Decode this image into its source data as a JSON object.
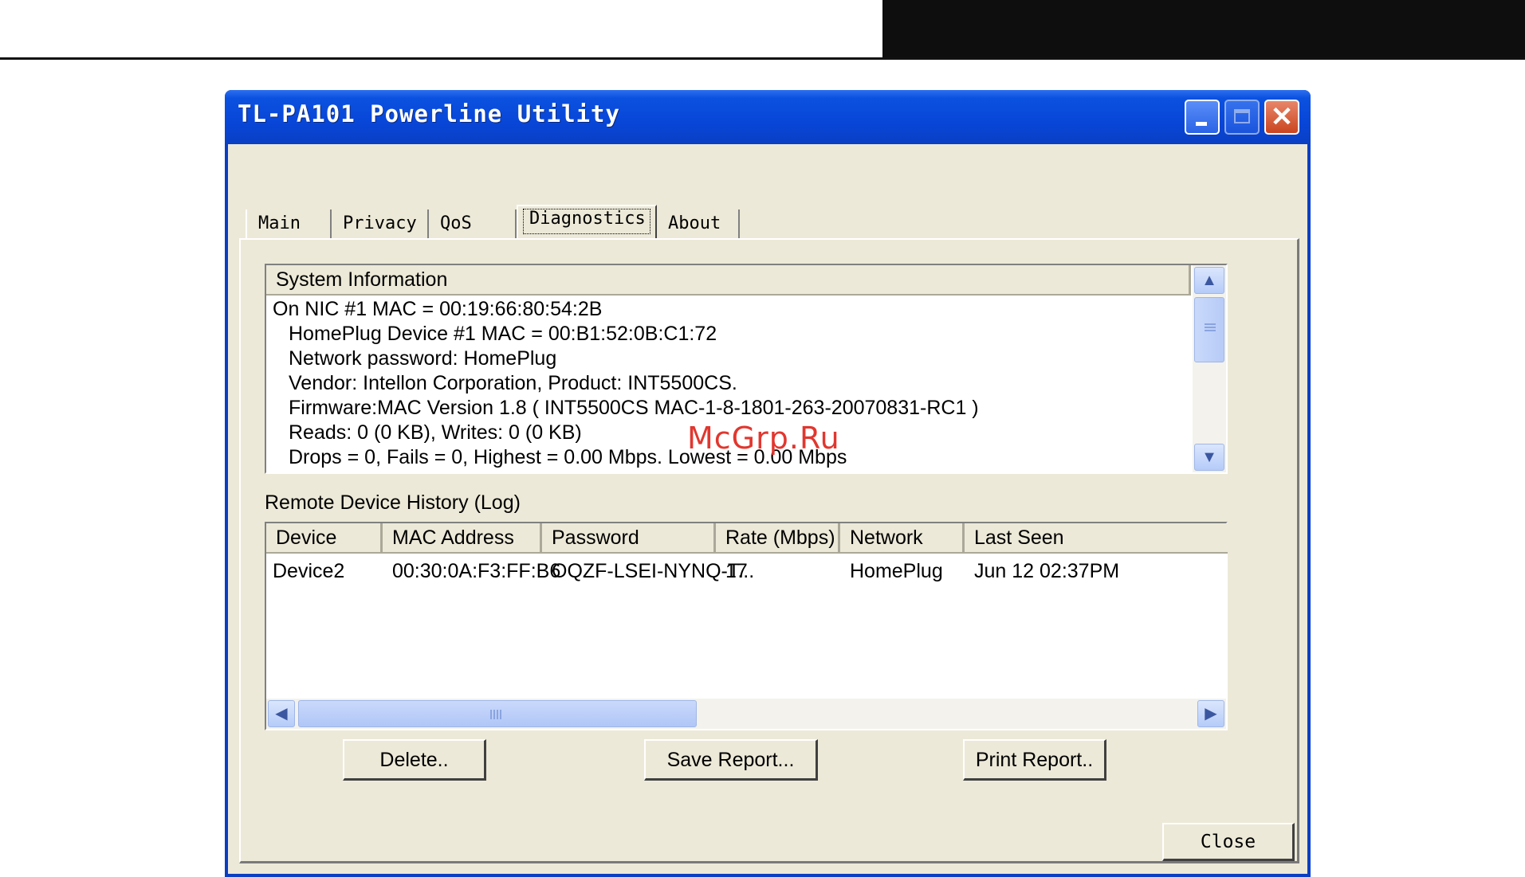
{
  "window": {
    "title": "TL-PA101 Powerline Utility",
    "close_glyph": "✕"
  },
  "tabs": [
    {
      "label": "Main"
    },
    {
      "label": "Privacy"
    },
    {
      "label": "QoS"
    },
    {
      "label": "Diagnostics",
      "selected": true
    },
    {
      "label": "About"
    }
  ],
  "system_info": {
    "header": "System Information",
    "lines": [
      "On NIC #1 MAC = 00:19:66:80:54:2B",
      "HomePlug Device #1 MAC = 00:B1:52:0B:C1:72",
      "Network password: HomePlug",
      "Vendor: Intellon Corporation, Product: INT5500CS.",
      "Firmware:MAC Version 1.8   ( INT5500CS MAC-1-8-1801-263-20070831-RC1 )",
      "Reads: 0 (0 KB), Writes: 0 (0 KB)",
      "Drops = 0, Fails = 0, Highest = 0.00 Mbps. Lowest = 0.00 Mbps"
    ]
  },
  "log": {
    "label": "Remote Device History (Log)",
    "columns": [
      "Device",
      "MAC Address",
      "Password",
      "Rate (Mbps)",
      "Network",
      "Last Seen"
    ],
    "rows": [
      [
        "Device2",
        "00:30:0A:F3:FF:B6",
        "OQZF-LSEI-NYNQ-T...",
        "17",
        "HomePlug",
        "Jun 12 02:37PM"
      ]
    ]
  },
  "buttons": {
    "delete": "Delete..",
    "save_report": "Save Report...",
    "print_report": "Print Report..",
    "close": "Close"
  },
  "scroll_glyphs": {
    "up": "▲",
    "down": "▼",
    "left": "◀",
    "right": "▶"
  },
  "watermark": "McGrp.Ru",
  "colors": {
    "titlebar": "#0846d8",
    "client_bg": "#ece9d8",
    "close_button": "#c9451f",
    "watermark": "#e1372f"
  }
}
